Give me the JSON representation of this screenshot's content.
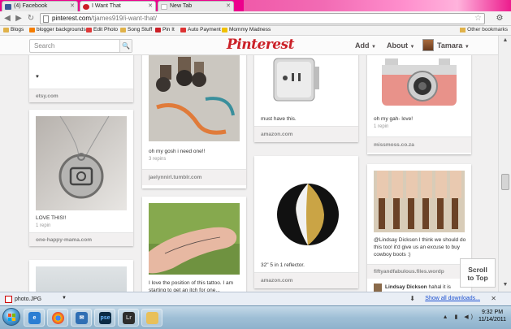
{
  "browser": {
    "tabs": [
      {
        "label": "(4) Facebook",
        "color": "#3b5998"
      },
      {
        "label": "I Want That",
        "color": "#cb2027"
      },
      {
        "label": "New Tab",
        "color": "#ffffff"
      }
    ],
    "url_host": "pinterest.com",
    "url_path": "/tjames919/i-want-that/",
    "bookmarks": [
      {
        "label": "Blogs",
        "color": "#e0b24a"
      },
      {
        "label": "blogger backgrounds",
        "color": "#f57d00"
      },
      {
        "label": "Edit Photo",
        "color": "#e03a3a"
      },
      {
        "label": "Song Stuff",
        "color": "#e0b24a"
      },
      {
        "label": "Pin It",
        "color": "#cb2027"
      },
      {
        "label": "Auto Payment",
        "color": "#d33"
      },
      {
        "label": "Mommy Madness",
        "color": "#f0c000"
      }
    ],
    "other_bookmarks": "Other bookmarks"
  },
  "header": {
    "search_placeholder": "Search",
    "logo": "Pinterest",
    "add_label": "Add",
    "about_label": "About",
    "user_name": "Tamara"
  },
  "pins": {
    "col1": [
      {
        "desc": "♥",
        "source": "etsy.com"
      },
      {
        "desc": "LOVE THIS!!",
        "stats": "1 repin",
        "source": "one-happy-mama.com"
      }
    ],
    "col2": [
      {
        "desc": "oh my gosh i need one!!",
        "stats": "3 repins",
        "source": "jaelynnirl.tumblr.com"
      },
      {
        "desc": "I love the position of this tattoo. I am starting to get an itch for one..."
      }
    ],
    "col3": [
      {
        "desc": "must have this.",
        "source": "amazon.com"
      },
      {
        "desc": "32\" 5 in 1 reflector.",
        "source": "amazon.com"
      }
    ],
    "col4": [
      {
        "desc": "oh my gah- love!",
        "stats": "1 repin",
        "source": "missmoss.co.za"
      },
      {
        "desc": "@Lindsay Dickson I think we should do this too! it'd give us an excuse to buy cowboy boots :)",
        "source": "fiftyandfabulous.files.wordp",
        "commenter": "Lindsay Dickson",
        "comment": "hahal it is"
      }
    ]
  },
  "scroll_top": [
    "Scroll",
    "to Top"
  ],
  "download": {
    "file": "photo.JPG",
    "show_all": "Show all downloads..."
  },
  "taskbar": {
    "time": "9:32 PM",
    "date": "11/14/2011",
    "apps": [
      "IE",
      "Chrome",
      "Outlook",
      "Photoshop",
      "Lightroom",
      "Folder"
    ]
  }
}
